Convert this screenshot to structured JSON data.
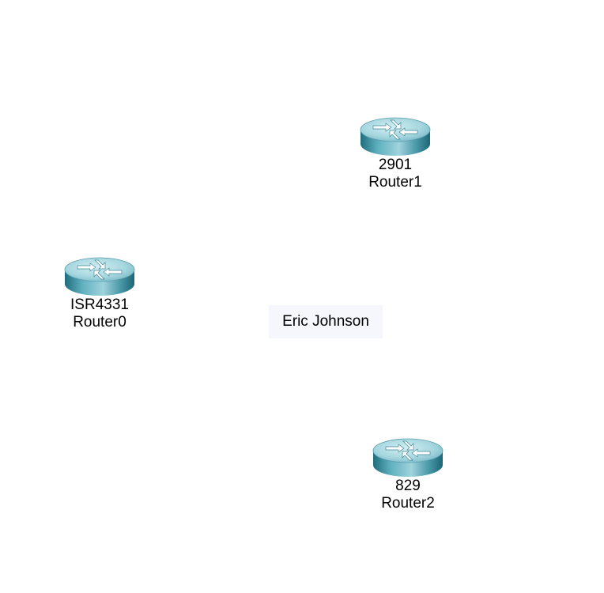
{
  "colors": {
    "router_body": "#4a98a8",
    "router_top": "#b8e2ea",
    "note_background": "#f6f7fd"
  },
  "devices": [
    {
      "model": "2901",
      "name": "Router1",
      "icon": "router-icon"
    },
    {
      "model": "ISR4331",
      "name": "Router0",
      "icon": "router-icon"
    },
    {
      "model": "829",
      "name": "Router2",
      "icon": "router-icon"
    }
  ],
  "note": {
    "text": "Eric Johnson"
  }
}
